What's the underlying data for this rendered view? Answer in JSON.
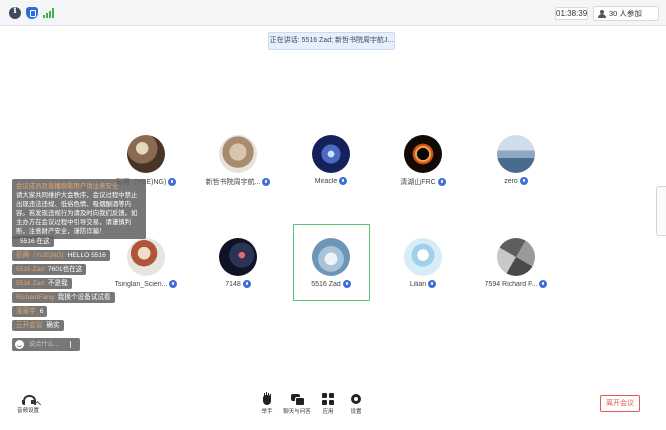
{
  "topbar": {
    "timer": "01:38:39",
    "attendees": "30 人参加"
  },
  "speaking_banner": "正在讲话: 5516 Zad; 新哲书院周宇航J...",
  "participants": [
    {
      "name": "彭两（YUE)NG)",
      "avatar_color": "#7b5e4a"
    },
    {
      "name": "新哲书院周宇航...",
      "avatar_color": "#b9a48f"
    },
    {
      "name": "Miracle",
      "avatar_color": "#1b2c6b"
    },
    {
      "name": "清湖山FRC",
      "avatar_color": "#1a0e08"
    },
    {
      "name": "zero",
      "avatar_color": "#8aa4c2"
    },
    {
      "name": "Tsinglan_Scien...",
      "avatar_color": "#9c6b52"
    },
    {
      "name": "7148",
      "avatar_color": "#17203a"
    },
    {
      "name": "5516 Zad",
      "avatar_color": "#7ba7c8"
    },
    {
      "name": "Lilian",
      "avatar_color": "#d2e7f4"
    },
    {
      "name": "7594 Richard F...",
      "avatar_color": "#6e6e6e"
    }
  ],
  "chat": {
    "notice_sender": "会议成员及直播观看用户请注意安全",
    "notice_text": "请大家共同维护大会秩序，会议过程中禁止出现违法违规、低俗色情、吸烟酗酒等内容。若发现违规行为请及时向我们反馈。如主办方在会议过程中引导交易，请谨慎判断，注意财产安全，谨防诈骗！",
    "messages": [
      {
        "sender": "",
        "text": "5516 在这"
      },
      {
        "sender": "彭两（YUE)NG)",
        "text": "HELLO 5516"
      },
      {
        "sender": "5516 Zad",
        "text": "7601也在这"
      },
      {
        "sender": "5516 Zad",
        "text": "不是我"
      },
      {
        "sender": "RichardFang",
        "text": "我换个设备试试看"
      },
      {
        "sender": "凌家宇",
        "text": "6"
      },
      {
        "sender": "云开会议",
        "text": "确实"
      }
    ],
    "input_placeholder": "说点什么..."
  },
  "toolbar": {
    "audio_label": "音频设置",
    "raise_hand_label": "举手",
    "chat_label": "聊天与问答",
    "apps_label": "应用",
    "settings_label": "设置",
    "leave_label": "离开会议"
  },
  "colors": {
    "accent_blue": "#3f6fd6",
    "leave_red": "#e05a4c",
    "selected_green": "#58c27a",
    "chat_sender": "#e8a46a"
  }
}
